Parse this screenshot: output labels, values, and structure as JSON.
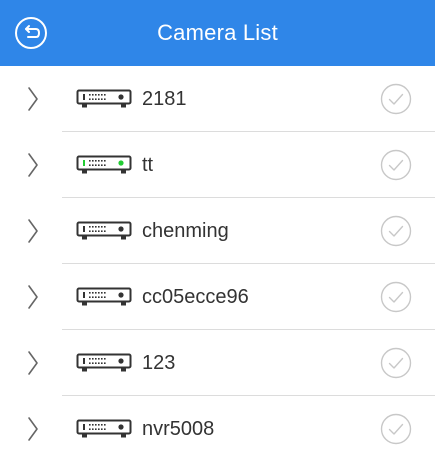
{
  "header": {
    "title": "Camera List",
    "back_icon": "back-circle-icon"
  },
  "colors": {
    "header_bg": "#2f86e8",
    "online_indicator": "#22cc33",
    "icon_stroke": "#333333",
    "check_stroke": "#c8c8c8"
  },
  "devices": [
    {
      "name": "2181",
      "online": false
    },
    {
      "name": "tt",
      "online": true
    },
    {
      "name": "chenming",
      "online": false
    },
    {
      "name": "cc05ecce96",
      "online": false
    },
    {
      "name": "123",
      "online": false
    },
    {
      "name": "nvr5008",
      "online": false
    }
  ]
}
